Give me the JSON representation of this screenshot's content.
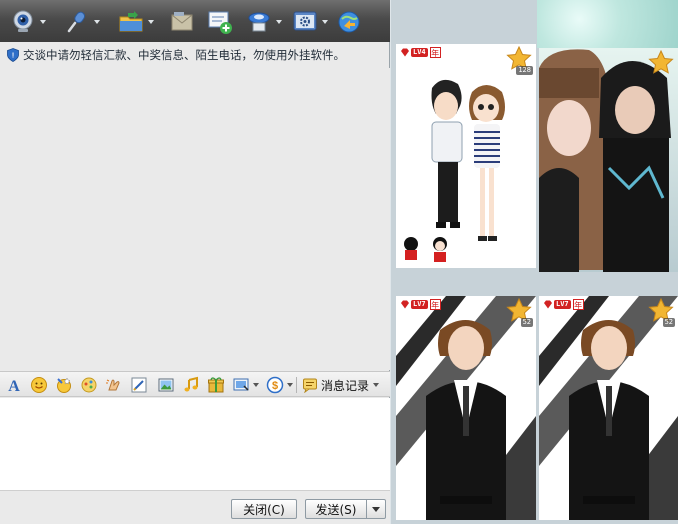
{
  "toolbar": {
    "buttons": [
      {
        "name": "video-call",
        "icon": "webcam-icon",
        "has_dropdown": true
      },
      {
        "name": "voice-call",
        "icon": "microphone-icon",
        "has_dropdown": true
      },
      {
        "name": "send-file",
        "icon": "folder-send-icon",
        "has_dropdown": true
      },
      {
        "name": "send-sms",
        "icon": "mail-icon",
        "has_dropdown": false
      },
      {
        "name": "create-discussion",
        "icon": "chat-add-icon",
        "has_dropdown": false
      },
      {
        "name": "remote-assist",
        "icon": "remote-desktop-icon",
        "has_dropdown": true
      },
      {
        "name": "app-settings",
        "icon": "application-gear-icon",
        "has_dropdown": true
      },
      {
        "name": "share-screen",
        "icon": "globe-share-icon",
        "has_dropdown": false
      }
    ]
  },
  "notice": {
    "icon": "shield-icon",
    "text": "交谈中请勿轻信汇款、中奖信息、陌生电话，勿使用外挂软件。"
  },
  "format_toolbar": {
    "tools": [
      "font-icon",
      "emoji-smile-icon",
      "magic-emoticon-icon",
      "doodle-icon",
      "shake-window-icon",
      "handwriting-icon",
      "image-icon",
      "music-icon",
      "gift-icon",
      "screenshot-icon",
      "money-icon"
    ],
    "history_label": "消息记录"
  },
  "buttons": {
    "close_label": "关闭(C)",
    "send_label": "发送(S)"
  },
  "show_panels": [
    {
      "level": "LV4",
      "badge": "年",
      "stars": "128"
    },
    {
      "level": "",
      "badge": "",
      "stars": ""
    },
    {
      "level": "LV7",
      "badge": "年",
      "stars": "52"
    },
    {
      "level": "LV7",
      "badge": "年",
      "stars": "52"
    }
  ],
  "colors": {
    "toolbar_bg": "#4a4a4a",
    "accent_red": "#d22222",
    "star_gold": "#f2b632",
    "window_bg": "#eaeaea"
  }
}
